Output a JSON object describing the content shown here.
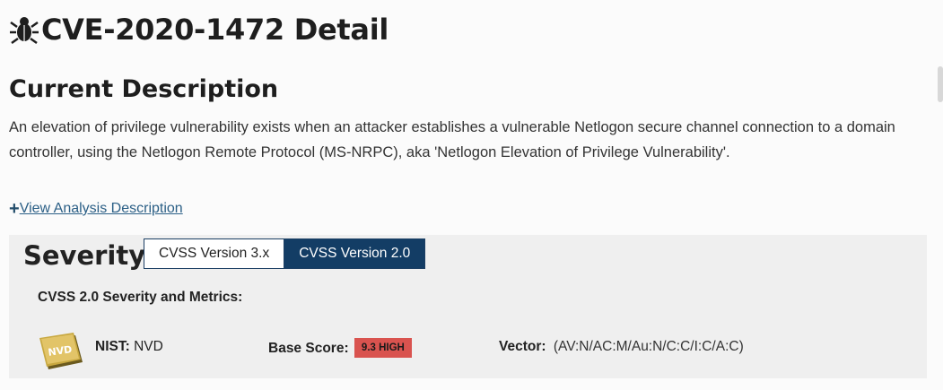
{
  "header": {
    "title": "CVE-2020-1472 Detail",
    "icon": "bug-icon"
  },
  "current_description": {
    "heading": "Current Description",
    "text": "An elevation of privilege vulnerability exists when an attacker establishes a vulnerable Netlogon secure channel connection to a domain controller, using the Netlogon Remote Protocol (MS-NRPC), aka 'Netlogon Elevation of Privilege Vulnerability'."
  },
  "analysis_link": {
    "plus": "+",
    "label": "View Analysis Description"
  },
  "severity": {
    "heading": "Severity",
    "tabs": [
      {
        "label": "CVSS Version 3.x",
        "active": false
      },
      {
        "label": "CVSS Version 2.0",
        "active": true
      }
    ],
    "metrics_heading": "CVSS 2.0 Severity and Metrics:",
    "logo_text": "NVD",
    "nist_label": "NIST:",
    "nist_value": "NVD",
    "base_score_label": "Base Score:",
    "base_score_value": "9.3 HIGH",
    "vector_label": "Vector:",
    "vector_value": "(AV:N/AC:M/Au:N/C:C/I:C/A:C)"
  },
  "colors": {
    "active_tab": "#133d65",
    "link": "#2b5f86",
    "score_badge": "#d9534f",
    "panel_bg": "#efefef"
  }
}
